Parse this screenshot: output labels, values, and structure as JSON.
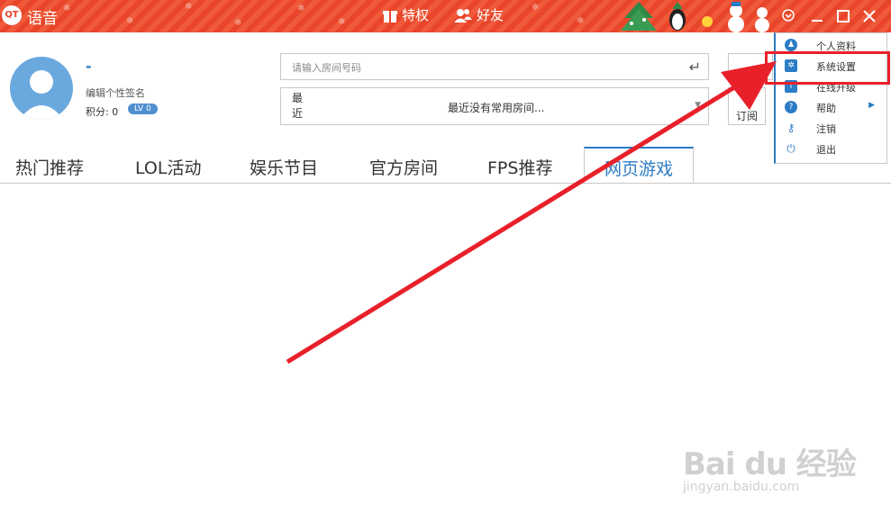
{
  "titlebar": {
    "logo": "QT",
    "app_name": "语音",
    "privilege_label": "特权",
    "friends_label": "好友",
    "controls": [
      "chevron-down-icon",
      "minimize-icon",
      "maximize-icon",
      "close-icon"
    ]
  },
  "profile": {
    "nickname": "-",
    "signature": "编辑个性签名",
    "score_label": "积分:",
    "score_value": "0",
    "level": "LV 0"
  },
  "search": {
    "placeholder": "请输入房间号码"
  },
  "recent": {
    "label": "最近",
    "value": "最近没有常用房间..."
  },
  "subscribe_label": "订阅",
  "tabs": [
    {
      "label": "热门推荐"
    },
    {
      "label": "LOL活动"
    },
    {
      "label": "娱乐节目"
    },
    {
      "label": "官方房间"
    },
    {
      "label": "FPS推荐"
    },
    {
      "label": "网页游戏"
    }
  ],
  "active_tab": "网页游戏",
  "menu": {
    "items": [
      {
        "label": "个人资料",
        "icon": "user-icon"
      },
      {
        "label": "系统设置",
        "icon": "gear-icon"
      },
      {
        "label": "在线升级",
        "icon": "upgrade-icon"
      },
      {
        "label": "帮助",
        "icon": "help-icon"
      },
      {
        "label": "注销",
        "icon": "key-icon"
      },
      {
        "label": "退出",
        "icon": "power-icon"
      }
    ]
  },
  "colors": {
    "titlebar": "#e8452a",
    "accent": "#2b7cc4",
    "annotation": "#e8202a"
  },
  "watermark": {
    "main": "Bai du 经验",
    "sub": "jingyan.baidu.com"
  }
}
